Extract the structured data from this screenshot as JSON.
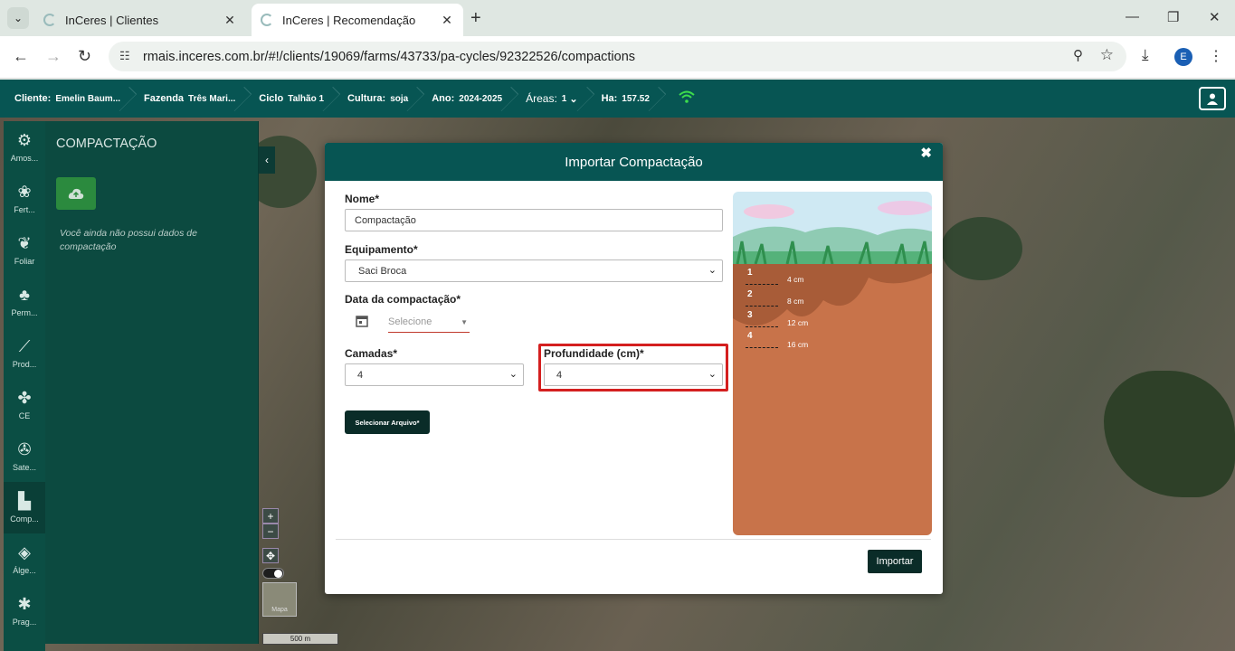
{
  "browser": {
    "tabs": [
      {
        "title": "InCeres | Clientes"
      },
      {
        "title": "InCeres | Recomendação"
      }
    ],
    "url": "rmais.inceres.com.br/#!/clients/19069/farms/43733/pa-cycles/92322526/compactions",
    "profile_initial": "E"
  },
  "header": {
    "crumbs": [
      {
        "label": "Cliente:",
        "value": "Emelin Baum..."
      },
      {
        "label": "Fazenda",
        "value": "Três Mari..."
      },
      {
        "label": "Ciclo",
        "value": "Talhão 1"
      },
      {
        "label": "Cultura:",
        "value": "soja"
      },
      {
        "label": "Ano:",
        "value": "2024-2025"
      },
      {
        "label": "Áreas:",
        "value": "1"
      },
      {
        "label": "Ha:",
        "value": "157.52"
      }
    ]
  },
  "rail": [
    {
      "label": "Amos...",
      "icon": "sampling-icon"
    },
    {
      "label": "Fert...",
      "icon": "fertility-icon"
    },
    {
      "label": "Foliar",
      "icon": "leaf-icon"
    },
    {
      "label": "Perm...",
      "icon": "plants-icon"
    },
    {
      "label": "Prod...",
      "icon": "chart-line-icon"
    },
    {
      "label": "CE",
      "icon": "sprout-icon"
    },
    {
      "label": "Sate...",
      "icon": "satellite-icon"
    },
    {
      "label": "Comp...",
      "icon": "compaction-icon"
    },
    {
      "label": "Álge...",
      "icon": "layers-icon"
    },
    {
      "label": "Prag...",
      "icon": "bug-icon"
    }
  ],
  "panel": {
    "title": "COMPACTAÇÃO",
    "empty_text": "Você ainda não possui dados de compactação"
  },
  "map": {
    "thumb_label": "Mapa",
    "scale": "500 m"
  },
  "modal": {
    "title": "Importar Compactação",
    "nome_label": "Nome*",
    "nome_value": "Compactação",
    "equip_label": "Equipamento*",
    "equip_value": "Saci Broca",
    "data_label": "Data da compactação*",
    "data_placeholder": "Selecione",
    "camadas_label": "Camadas*",
    "camadas_value": "4",
    "prof_label": "Profundidade (cm)*",
    "prof_value": "4",
    "select_file": "Selecionar Arquivo*",
    "import": "Importar",
    "layers": [
      {
        "n": "1",
        "depth": "4 cm"
      },
      {
        "n": "2",
        "depth": "8 cm"
      },
      {
        "n": "3",
        "depth": "12 cm"
      },
      {
        "n": "4",
        "depth": "16 cm"
      }
    ]
  }
}
